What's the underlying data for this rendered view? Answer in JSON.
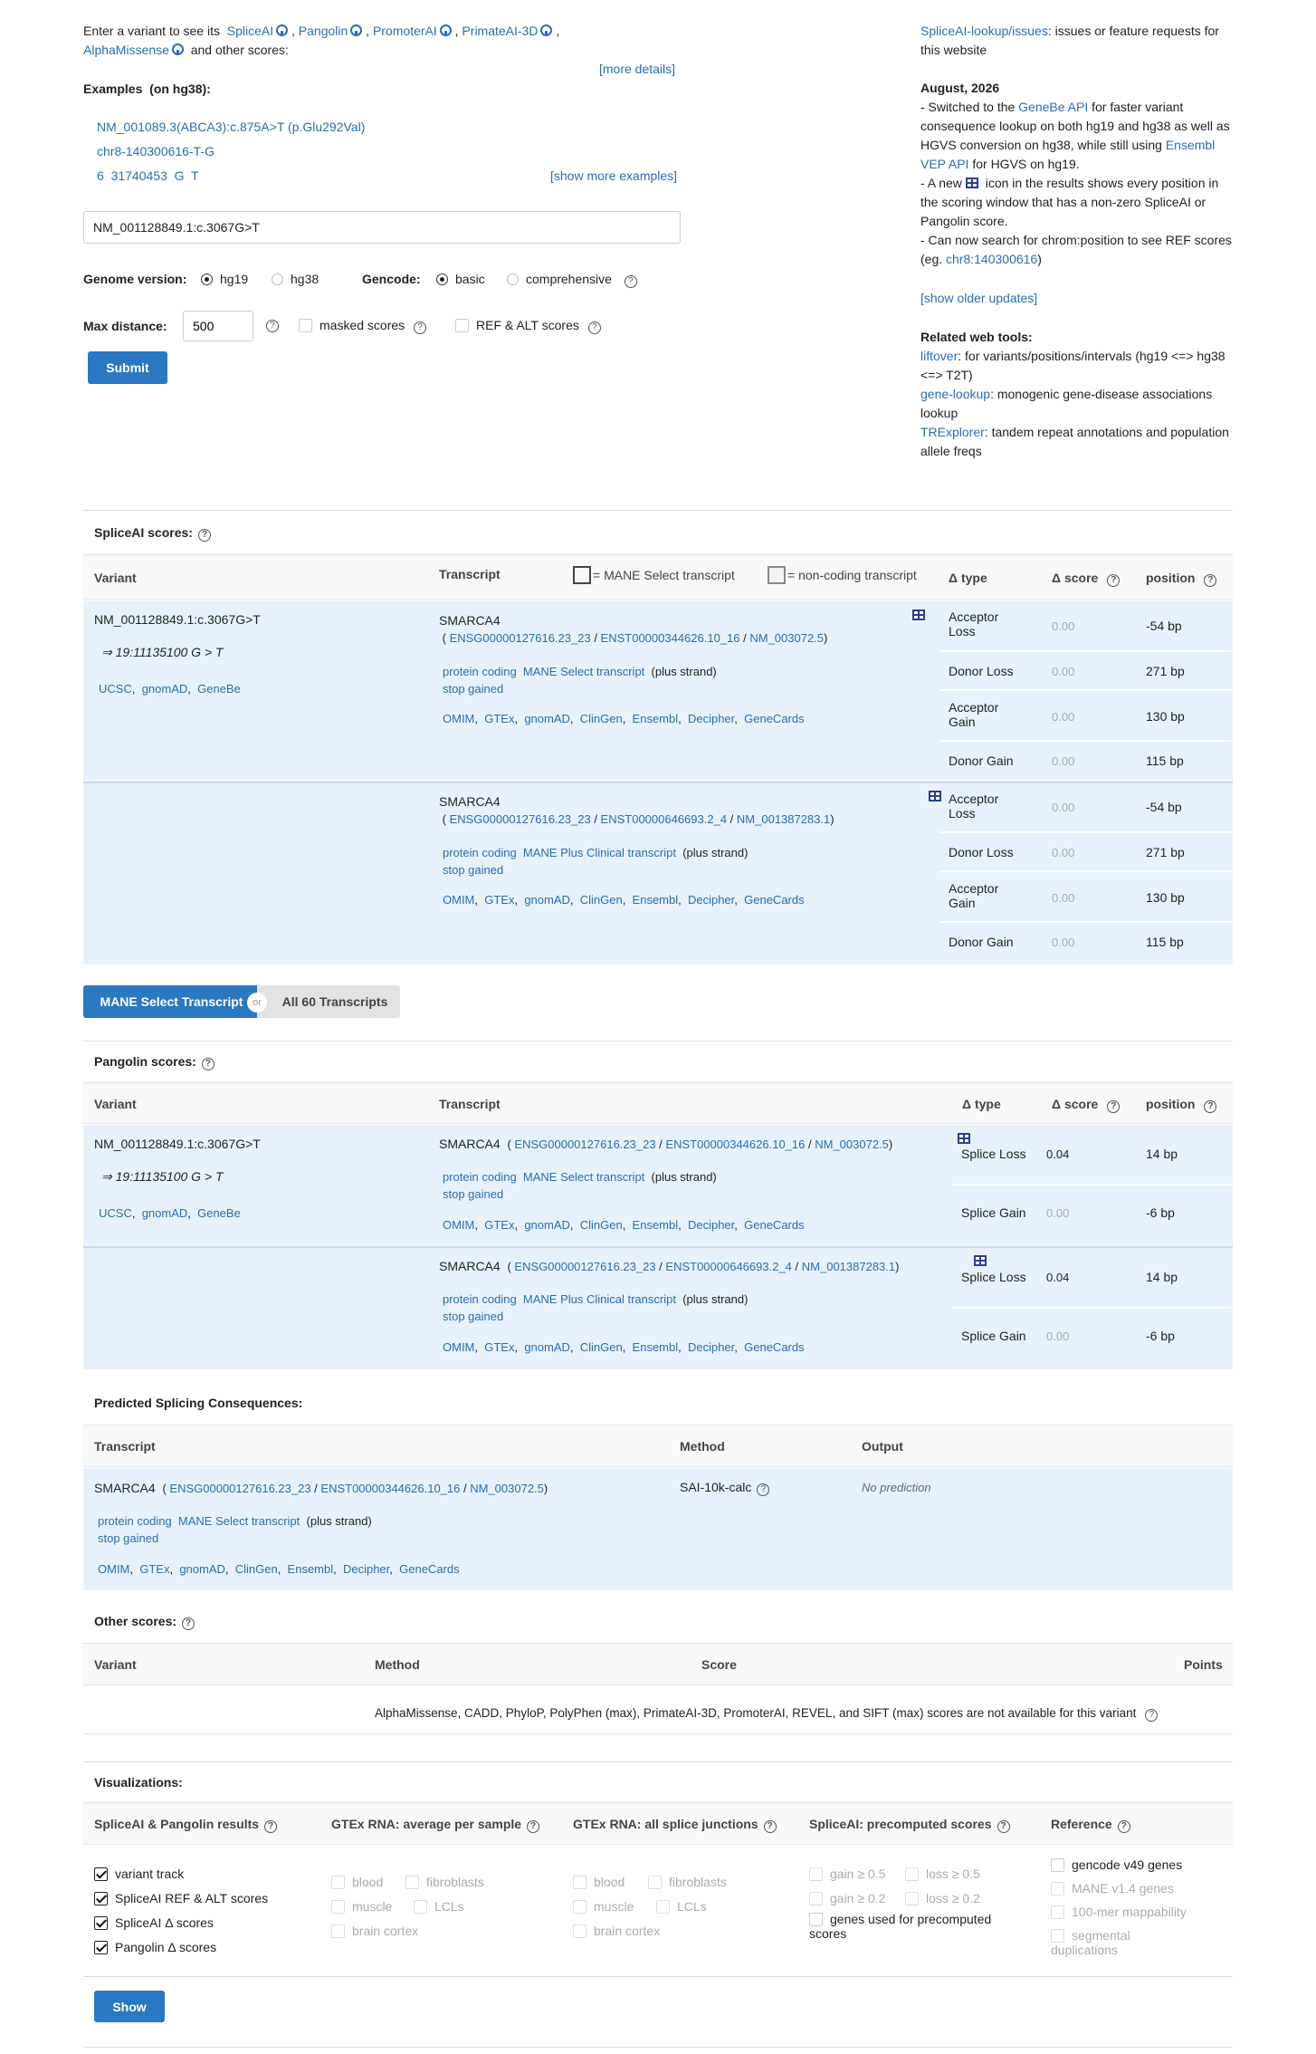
{
  "intro": {
    "line1_prefix": "Enter a variant to see its",
    "tools": [
      "SpliceAI",
      "Pangolin",
      "PromoterAI",
      "PrimateAI-3D"
    ],
    "line2_tool": "AlphaMissense",
    "line2_suffix": "and other scores:",
    "more_details": "[more details]"
  },
  "examples": {
    "label": "Examples",
    "build": "(on hg38):",
    "items": [
      "NM_001089.3(ABCA3):c.875A>T (p.Glu292Val)",
      "chr8-140300616-T-G",
      "6  31740453  G  T"
    ],
    "show_more": "[show more examples]"
  },
  "search": {
    "value": "NM_001128849.1:c.3067G>T"
  },
  "genome": {
    "label": "Genome version:",
    "options": [
      "hg19",
      "hg38"
    ],
    "selected": "hg19"
  },
  "gencode": {
    "label": "Gencode:",
    "options": [
      "basic",
      "comprehensive"
    ],
    "selected": "basic"
  },
  "maxdist": {
    "label": "Max distance:",
    "value": "500"
  },
  "masked": {
    "label": "masked scores"
  },
  "refalt": {
    "label": "REF & ALT scores"
  },
  "submit": "Submit",
  "right": {
    "issues_link": "SpliceAI-lookup/issues",
    "issues_text": ": issues or feature requests for this website",
    "date": "August, 2026",
    "u1_a": "- Switched to the ",
    "u1_link": "GeneBe API",
    "u1_b": " for faster variant consequence lookup on both hg19 and hg38 as well as HGVS conversion on hg38, while still using ",
    "u1_link2": "Ensembl VEP API",
    "u1_c": " for HGVS on hg19.",
    "u2_a": "- A new ",
    "u2_b": " icon in the results shows every position in the scoring window that has a non-zero SpliceAI or Pangolin score.",
    "u3_a": "- Can now search for chrom:position to see REF scores (eg. ",
    "u3_link": "chr8:140300616",
    "u3_b": ")",
    "older": "[show older updates]",
    "related_title": "Related web tools:",
    "tools": [
      {
        "name": "liftover",
        "desc": ": for variants/positions/intervals (hg19 <=> hg38 <=> T2T)"
      },
      {
        "name": "gene-lookup",
        "desc": ": monogenic gene-disease associations lookup"
      },
      {
        "name": "TRExplorer",
        "desc": ": tandem repeat annotations and population allele freqs"
      }
    ]
  },
  "spliceai": {
    "title": "SpliceAI scores:",
    "headers": {
      "variant": "Variant",
      "transcript": "Transcript",
      "mane": "= MANE Select transcript",
      "noncoding": "= non-coding transcript",
      "dtype": "Δ type",
      "dscore": "Δ score",
      "position": "position"
    },
    "variant": "NM_001128849.1:c.3067G>T",
    "genomic": "⇒ 19:11135100 G > T",
    "vlinks": [
      "UCSC",
      "gnomAD",
      "GeneBe"
    ],
    "transcripts": [
      {
        "gene": "SMARCA4",
        "ensg": "ENSG00000127616.23_23",
        "enst": "ENST00000344626.10_16",
        "nm": "NM_003072.5",
        "biotype": "protein coding",
        "tag": "MANE Select transcript",
        "strand": "(plus strand)",
        "effect": "stop gained",
        "rows": [
          {
            "type": "Acceptor Loss",
            "score": "0.00",
            "pos": "-54 bp"
          },
          {
            "type": "Donor Loss",
            "score": "0.00",
            "pos": "271 bp"
          },
          {
            "type": "Acceptor Gain",
            "score": "0.00",
            "pos": "130 bp"
          },
          {
            "type": "Donor Gain",
            "score": "0.00",
            "pos": "115 bp"
          }
        ]
      },
      {
        "gene": "SMARCA4",
        "ensg": "ENSG00000127616.23_23",
        "enst": "ENST00000646693.2_4",
        "nm": "NM_001387283.1",
        "biotype": "protein coding",
        "tag": "MANE Plus Clinical transcript",
        "strand": "(plus strand)",
        "effect": "stop gained",
        "rows": [
          {
            "type": "Acceptor Loss",
            "score": "0.00",
            "pos": "-54 bp"
          },
          {
            "type": "Donor Loss",
            "score": "0.00",
            "pos": "271 bp"
          },
          {
            "type": "Acceptor Gain",
            "score": "0.00",
            "pos": "130 bp"
          },
          {
            "type": "Donor Gain",
            "score": "0.00",
            "pos": "115 bp"
          }
        ]
      }
    ],
    "dblinks": [
      "OMIM",
      "GTEx",
      "gnomAD",
      "ClinGen",
      "Ensembl",
      "Decipher",
      "GeneCards"
    ]
  },
  "toggle": {
    "left": "MANE Select Transcript",
    "or": "or",
    "right": "All 60 Transcripts"
  },
  "pangolin": {
    "title": "Pangolin scores:",
    "headers": {
      "variant": "Variant",
      "transcript": "Transcript",
      "dtype": "Δ type",
      "dscore": "Δ score",
      "position": "position"
    },
    "transcripts": [
      {
        "gene": "SMARCA4",
        "ensg": "ENSG00000127616.23_23",
        "enst": "ENST00000344626.10_16",
        "nm": "NM_003072.5",
        "biotype": "protein coding",
        "tag": "MANE Select transcript",
        "strand": "(plus strand)",
        "effect": "stop gained",
        "rows": [
          {
            "type": "Splice Loss",
            "score": "0.04",
            "pos": "14 bp"
          },
          {
            "type": "Splice Gain",
            "score": "0.00",
            "pos": "-6 bp"
          }
        ]
      },
      {
        "gene": "SMARCA4",
        "ensg": "ENSG00000127616.23_23",
        "enst": "ENST00000646693.2_4",
        "nm": "NM_001387283.1",
        "biotype": "protein coding",
        "tag": "MANE Plus Clinical transcript",
        "strand": "(plus strand)",
        "effect": "stop gained",
        "rows": [
          {
            "type": "Splice Loss",
            "score": "0.04",
            "pos": "14 bp"
          },
          {
            "type": "Splice Gain",
            "score": "0.00",
            "pos": "-6 bp"
          }
        ]
      }
    ]
  },
  "predicted": {
    "title": "Predicted Splicing Consequences:",
    "headers": {
      "transcript": "Transcript",
      "method": "Method",
      "output": "Output"
    },
    "gene": "SMARCA4",
    "ensg": "ENSG00000127616.23_23",
    "enst": "ENST00000344626.10_16",
    "nm": "NM_003072.5",
    "biotype": "protein coding",
    "tag": "MANE Select transcript",
    "strand": "(plus strand)",
    "effect": "stop gained",
    "method": "SAI-10k-calc",
    "output": "No prediction"
  },
  "other": {
    "title": "Other scores:",
    "headers": {
      "variant": "Variant",
      "method": "Method",
      "score": "Score",
      "points": "Points"
    },
    "message": "AlphaMissense,  CADD,  PhyloP,  PolyPhen (max),  PrimateAI-3D,  PromoterAI,  REVEL,  and SIFT (max) scores are not available for this variant"
  },
  "viz": {
    "title": "Visualizations:",
    "cols": [
      "SpliceAI & Pangolin results",
      "GTEx RNA: average per sample",
      "GTEx RNA: all splice junctions",
      "SpliceAI: precomputed scores",
      "Reference"
    ],
    "results": [
      "variant track",
      "SpliceAI REF & ALT scores",
      "SpliceAI Δ  scores",
      "Pangolin Δ  scores"
    ],
    "gtex_avg": [
      "blood",
      "fibroblasts",
      "muscle",
      "LCLs",
      "brain cortex"
    ],
    "gtex_junc": [
      "blood",
      "fibroblasts",
      "muscle",
      "LCLs",
      "brain cortex"
    ],
    "precomp": [
      "gain ≥ 0.5",
      "loss ≥ 0.5",
      "gain ≥ 0.2",
      "loss ≥ 0.2",
      "genes used for precomputed scores"
    ],
    "reference": [
      "gencode v49 genes",
      "MANE v1.4 genes",
      "100-mer mappability",
      "segmental duplications"
    ],
    "show": "Show"
  }
}
